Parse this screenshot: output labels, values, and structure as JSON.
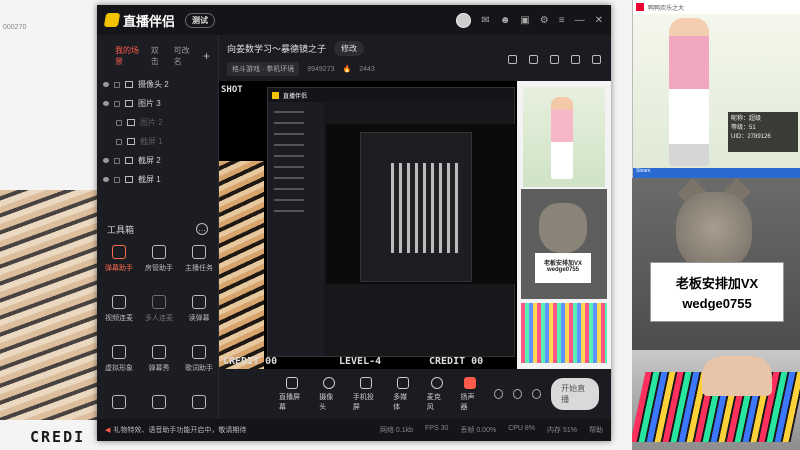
{
  "desktop": {
    "label": "000270",
    "credit_text": "CREDI"
  },
  "app": {
    "logo": "直播伴侣",
    "version_badge": "测试",
    "scene_tabs": [
      "我的场景",
      "双击",
      "可改名"
    ],
    "sources": [
      {
        "name": "摄像头 2",
        "visible": true
      },
      {
        "name": "图片 3",
        "visible": true
      },
      {
        "name": "图片 2",
        "visible": false
      },
      {
        "name": "截屏 1",
        "visible": false
      },
      {
        "name": "截屏 2",
        "visible": true
      },
      {
        "name": "截屏 1",
        "visible": true
      }
    ],
    "tools_title": "工具箱",
    "tools": [
      "弹幕助手",
      "房管助手",
      "主播任务",
      "视频连麦",
      "多人连麦",
      "读弹幕",
      "虚拟形象",
      "弹幕秀",
      "歌词助手",
      "",
      "",
      ""
    ],
    "room_title": "向姜数学习～暴德镜之子",
    "edit_label": "修改",
    "category_tag": "格斗游戏 · 拳机环境",
    "room_id": "9949273",
    "heat": "2443",
    "preview_text": {
      "credit": "CREDIT 00",
      "level": "LEVEL-4",
      "right": "CREDIT 00",
      "side": "SHOT"
    },
    "bottom_buttons": [
      "直播屏幕",
      "摄像头",
      "手机投屏",
      "多媒体",
      "麦克风",
      "扬声器"
    ],
    "live_button": "开始直播",
    "status_notice": "礼物特效、语音助手功能开启中，敬请期待",
    "stats": [
      "网络 0.1kb",
      "FPS 30",
      "丢帧 0.00%",
      "CPU 8%",
      "内存 51%",
      "帮助"
    ]
  },
  "right_window": {
    "title": "鸭鸭欢乐之大",
    "info_lines": [
      "昵称：超级",
      "等级：51",
      "UID：2789126"
    ],
    "status": "Steam"
  },
  "cat_sign": {
    "line1": "老板安排加VX",
    "line2": "wedge0755"
  },
  "mini_sign": {
    "line1": "老板安排加VX",
    "line2": "wedge0755"
  }
}
